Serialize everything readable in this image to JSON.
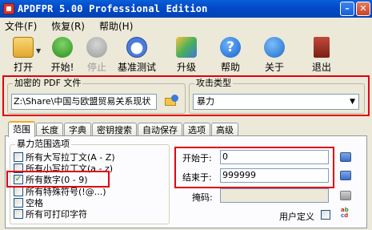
{
  "window": {
    "title": "APDFPR 5.00 Professional Edition"
  },
  "menu": [
    "文件(F)",
    "恢复(R)",
    "帮助(H)"
  ],
  "toolbar": [
    {
      "label": "打开",
      "icon": "open-folder-icon",
      "enabled": true
    },
    {
      "label": "开始!",
      "icon": "start-icon",
      "enabled": true
    },
    {
      "label": "停止",
      "icon": "stop-icon",
      "enabled": false
    },
    {
      "label": "基准测试",
      "icon": "stopwatch-icon",
      "enabled": true
    },
    {
      "label": "升级",
      "icon": "upgrade-icon",
      "enabled": true
    },
    {
      "label": "帮助",
      "icon": "help-icon",
      "enabled": true
    },
    {
      "label": "关于",
      "icon": "about-icon",
      "enabled": true
    },
    {
      "label": "退出",
      "icon": "exit-door-icon",
      "enabled": true
    }
  ],
  "encrypted_file": {
    "label": "加密的 PDF 文件",
    "path": "Z:\\Share\\中国与欧盟贸易关系现状"
  },
  "attack_type": {
    "label": "攻击类型",
    "selected": "暴力"
  },
  "tabs": [
    "范围",
    "长度",
    "字典",
    "密钥搜索",
    "自动保存",
    "选项",
    "高级"
  ],
  "active_tab": "范围",
  "brute_force": {
    "label": "暴力范围选项",
    "options": [
      {
        "label": "所有大写拉丁文(A - Z)",
        "checked": false
      },
      {
        "label": "所有小写拉丁文(a - z)",
        "checked": false
      },
      {
        "label": "所有数字(0 - 9)",
        "checked": true
      },
      {
        "label": "所有特殊符号(!@...)",
        "checked": false
      },
      {
        "label": "空格",
        "checked": false
      },
      {
        "label": "所有可打印字符",
        "checked": false
      }
    ]
  },
  "range": {
    "start_label": "开始于:",
    "start_value": "0",
    "end_label": "结束于:",
    "end_value": "999999",
    "mask_label": "掩码:",
    "mask_value": "",
    "user_defined_label": "用户定义"
  },
  "colors": {
    "highlight": "#e0000f",
    "titlebar": "#0348c7"
  }
}
